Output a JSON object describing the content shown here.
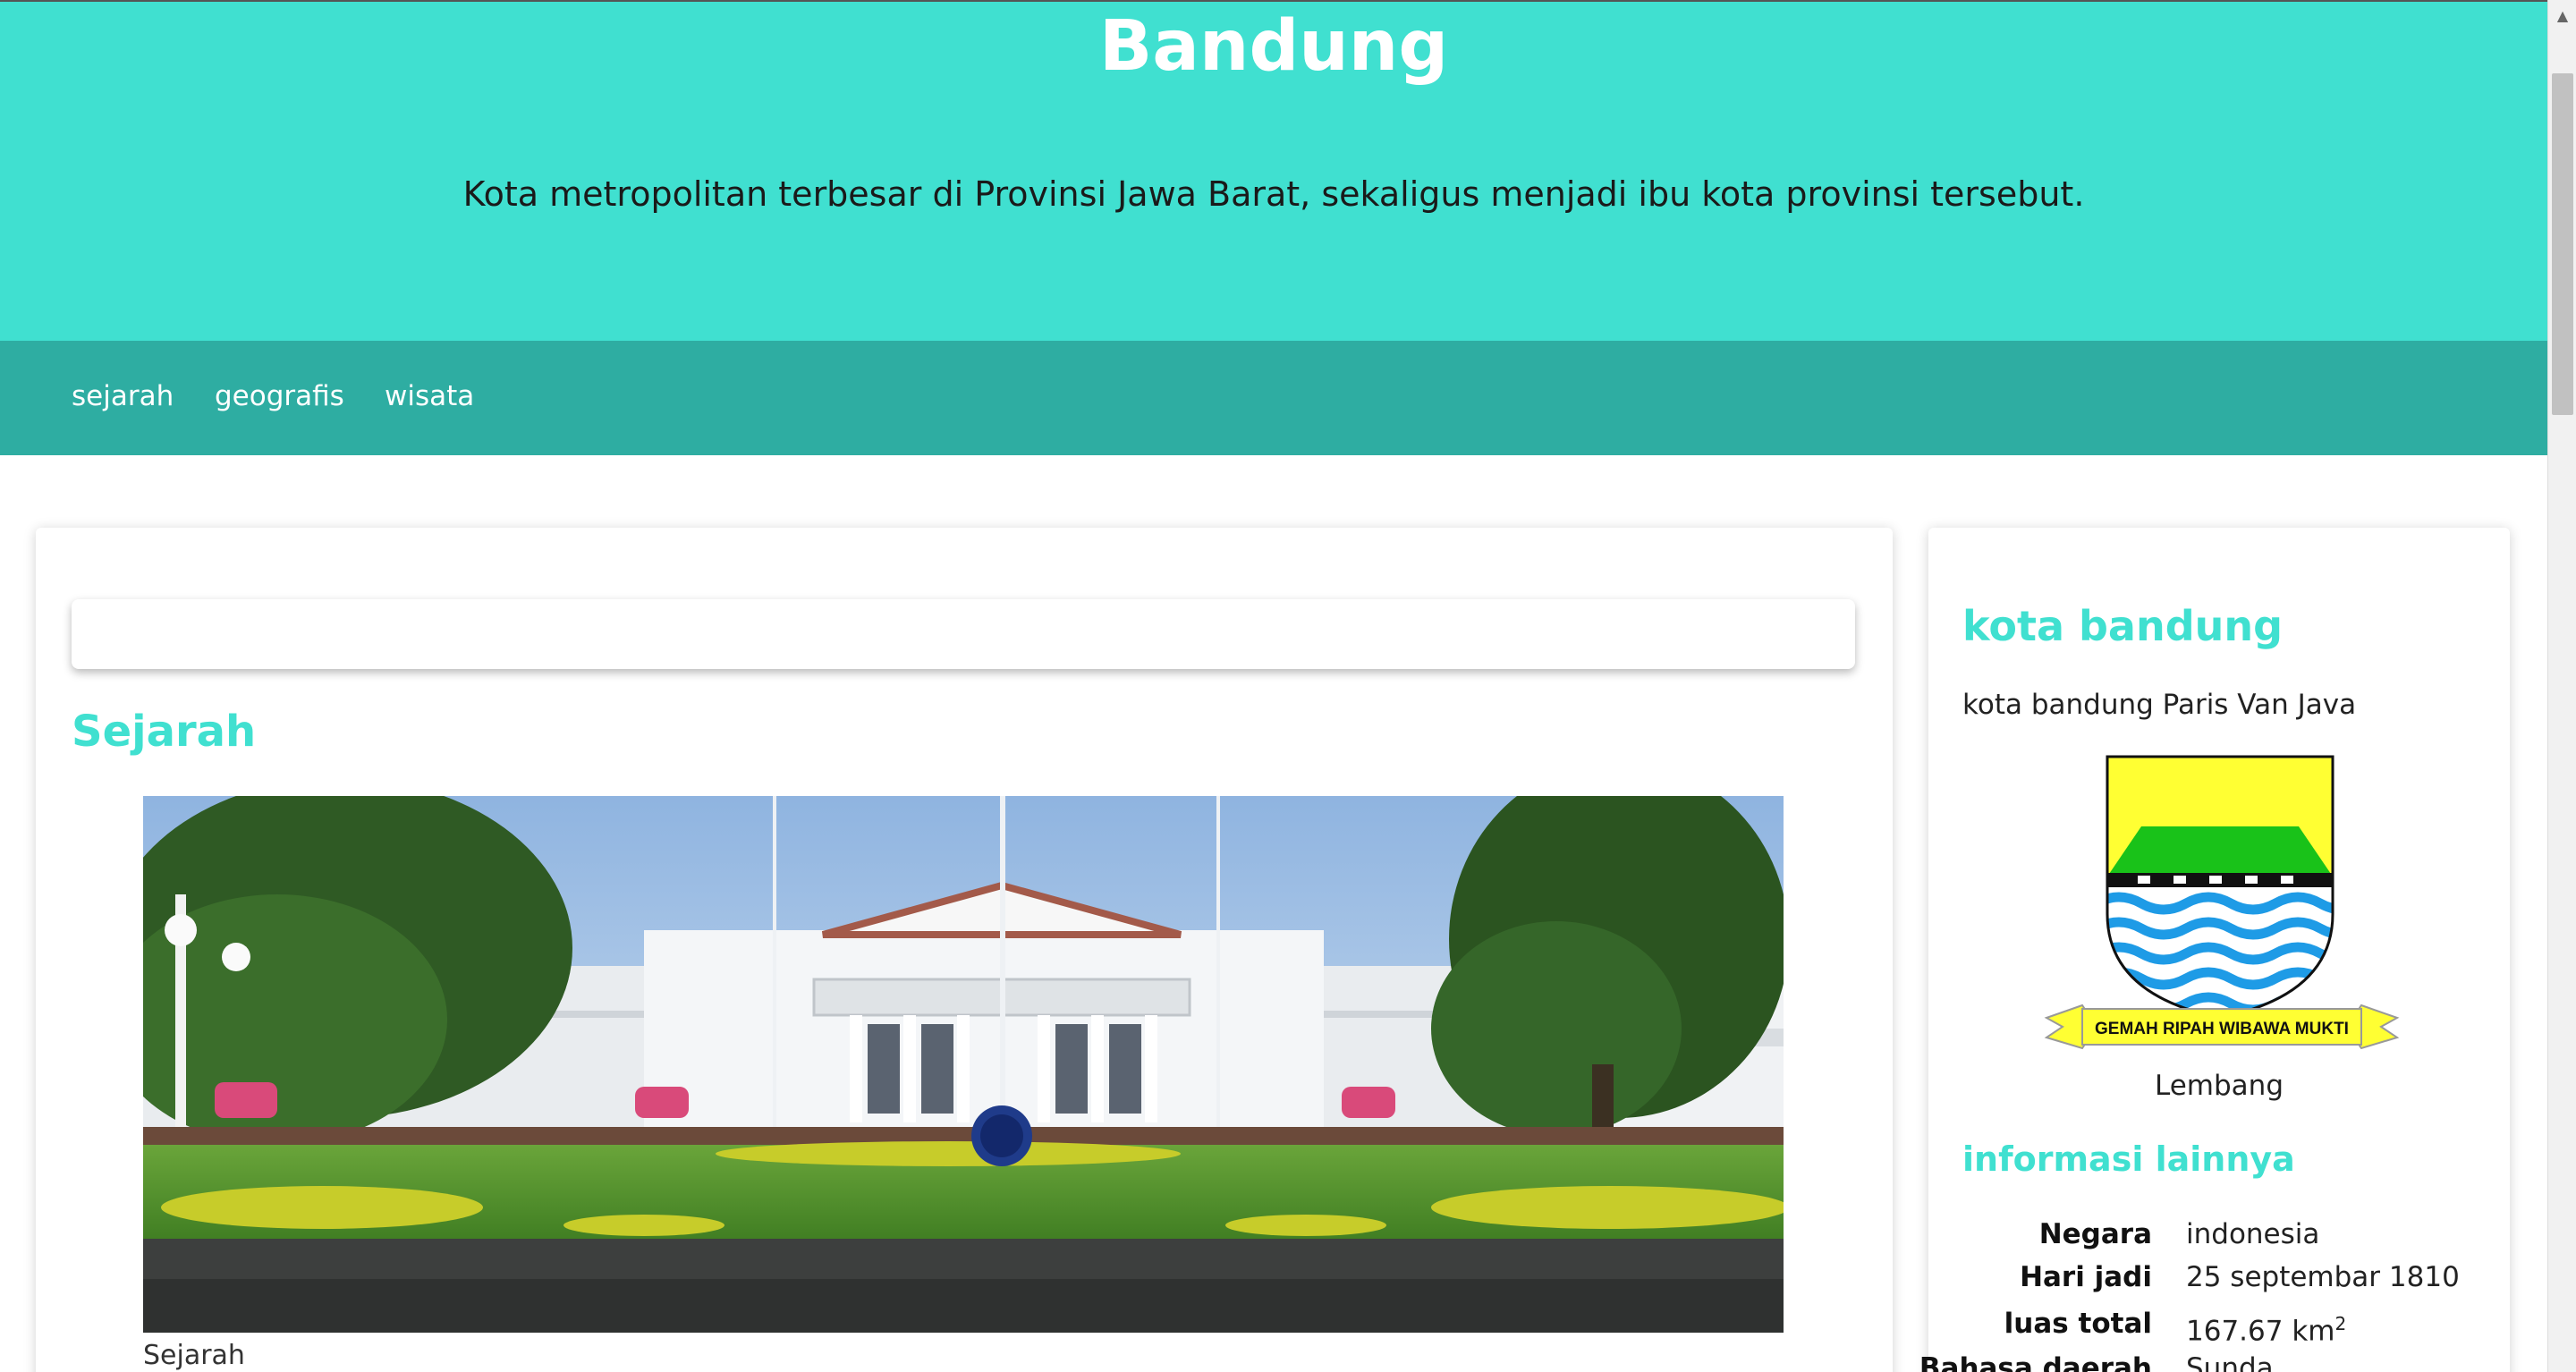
{
  "header": {
    "title": "Bandung",
    "subtitle": "Kota metropolitan terbesar di Provinsi Jawa Barat, sekaligus menjadi ibu kota provinsi tersebut."
  },
  "nav": {
    "items": [
      "sejarah",
      "geografis",
      "wisata"
    ]
  },
  "main": {
    "section_title": "Sejarah",
    "photo_caption": "Sejarah"
  },
  "sidebar": {
    "title": "kota bandung",
    "description": "kota bandung Paris Van Java",
    "emblem_motto": "GEMAH RIPAH WIBAWA MUKTI",
    "emblem_caption": "Lembang",
    "info_title": "informasi lainnya",
    "info": [
      {
        "label": "Negara",
        "value": "indonesia"
      },
      {
        "label": "Hari jadi",
        "value": "25 septembar 1810"
      },
      {
        "label": "luas total",
        "value": "167.67 km",
        "sup": "2"
      },
      {
        "label": "Bahasa daerah",
        "value": "Sunda"
      }
    ]
  },
  "colors": {
    "accent": "#40e0d0",
    "nav_bg": "#2eada2"
  }
}
